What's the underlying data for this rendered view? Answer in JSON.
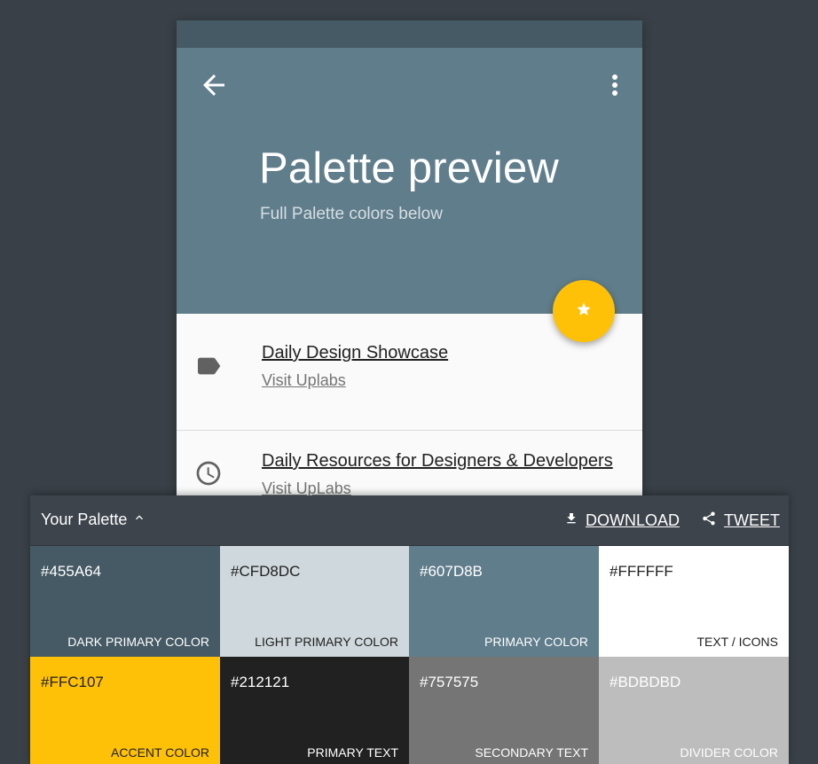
{
  "header": {
    "title": "Palette preview",
    "subtitle": "Full Palette colors below"
  },
  "list": [
    {
      "title": "Daily Design Showcase",
      "link": "Visit Uplabs",
      "icon": "label-icon"
    },
    {
      "title": "Daily Resources for Designers & Developers",
      "link": "Visit UpLabs",
      "icon": "clock-icon"
    }
  ],
  "palette": {
    "title": "Your Palette",
    "download_label": "DOWNLOAD",
    "tweet_label": "TWEET",
    "swatches": [
      {
        "hex": "#455A64",
        "label": "DARK PRIMARY COLOR",
        "bg": "#455A64",
        "fg": "#ffffff"
      },
      {
        "hex": "#CFD8DC",
        "label": "LIGHT PRIMARY COLOR",
        "bg": "#CFD8DC",
        "fg": "#212121"
      },
      {
        "hex": "#607D8B",
        "label": "PRIMARY COLOR",
        "bg": "#607D8B",
        "fg": "#ffffff"
      },
      {
        "hex": "#FFFFFF",
        "label": "TEXT / ICONS",
        "bg": "#FFFFFF",
        "fg": "#212121"
      },
      {
        "hex": "#FFC107",
        "label": "ACCENT COLOR",
        "bg": "#FFC107",
        "fg": "#212121"
      },
      {
        "hex": "#212121",
        "label": "PRIMARY TEXT",
        "bg": "#212121",
        "fg": "#ffffff"
      },
      {
        "hex": "#757575",
        "label": "SECONDARY TEXT",
        "bg": "#757575",
        "fg": "#ffffff"
      },
      {
        "hex": "#BDBDBD",
        "label": "DIVIDER COLOR",
        "bg": "#BDBDBD",
        "fg": "#ffffff"
      }
    ]
  },
  "colors": {
    "dark_primary": "#455A64",
    "primary": "#607D8B",
    "accent": "#FFC107",
    "background": "#394047"
  }
}
